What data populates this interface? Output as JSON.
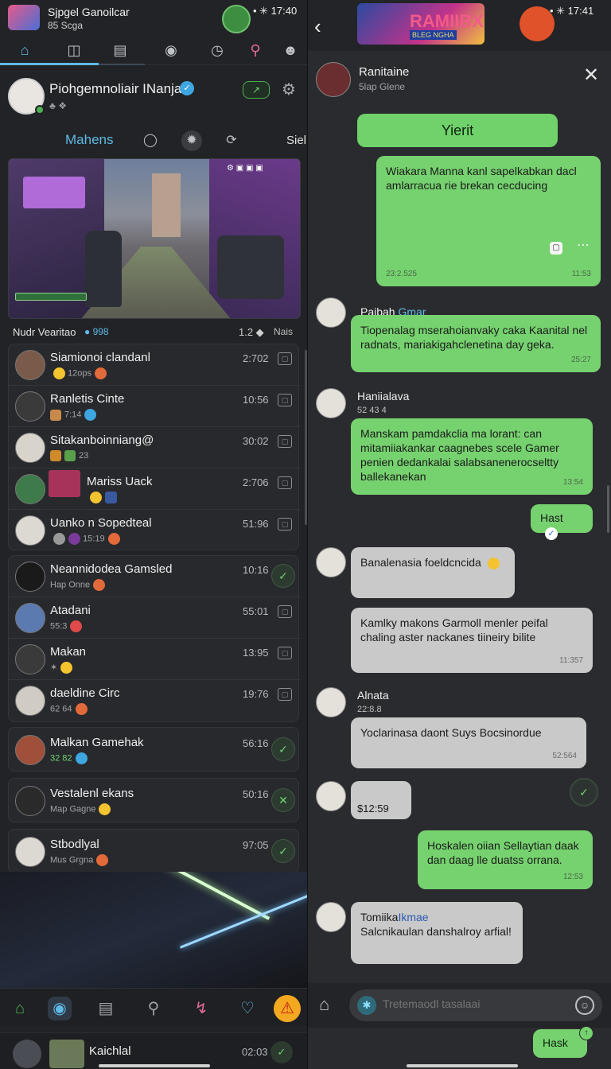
{
  "left": {
    "status": {
      "app_name": "Sjpgel Ganoilcar",
      "app_sub": "85 Scga",
      "system": "• ✳ 17:40"
    },
    "profile": {
      "name": "Piohgemnoliair INanjan",
      "sub": "♣ ❖",
      "trend_label": "↗"
    },
    "subtabs": {
      "active": "Mahens",
      "right": "Siel"
    },
    "game_image": {
      "hud": "⚙ ▣ ▣ ▣"
    },
    "list_head": {
      "title": "Nudr Vearitao",
      "count": "● 998",
      "num": "1.2 ◆",
      "right": "Nais"
    },
    "card1": [
      {
        "name": "Siamionoi clandanl",
        "sub": "12ops",
        "time": "2:702"
      },
      {
        "name": "Ranletis Cinte",
        "sub": "7:14",
        "time": "10:56"
      },
      {
        "name": "Sitakanboinniang@",
        "sub": "23",
        "time": "30:02"
      },
      {
        "name": "Mariss Uack",
        "sub": "",
        "time": "2:706"
      },
      {
        "name": "Uanko n Sopedteal",
        "sub": "15:19",
        "time": "51:96"
      }
    ],
    "card2": [
      {
        "name": "Neannidodea Gamsled",
        "sub": "Hap Onne",
        "time": "10:16"
      },
      {
        "name": "Atadani",
        "sub": "55:3",
        "time": "55:01"
      },
      {
        "name": "Makan",
        "sub": "✶",
        "time": "13:95"
      },
      {
        "name": "daeldine Circ",
        "sub": "62 64",
        "time": "19:76"
      }
    ],
    "card3": [
      {
        "name": "Malkan Gamehak",
        "sub": "32 82",
        "time": "56:16"
      }
    ],
    "card4": [
      {
        "name": "Vestalenl ekans",
        "sub": "Map Gagne",
        "time": "50:16"
      }
    ],
    "card5": [
      {
        "name": "Stbodlyal",
        "sub": "Mus Grgna",
        "time": "97:05"
      }
    ],
    "footer": {
      "name": "Kaichlal",
      "time": "02:03"
    }
  },
  "right": {
    "status": {
      "logo_text": "RAMIIBX",
      "logo_sub": "BLEG NGHA",
      "system": "• ✳ 17:41"
    },
    "chat": {
      "name": "Ranitaine",
      "sub": "5lap Glene"
    },
    "action_label": "Yierit",
    "messages": [
      {
        "text": "Wiakara Manna kanl sapelkabkan dacl amlarracua rie brekan cecducing",
        "meta": "11:53",
        "meta_left": "23:2.525"
      },
      {
        "sender": "Paibah",
        "sender2": "Gmar",
        "text": "Tiopenalag mserahoianvaky caka Kaanital nel radnats, mariakigahclenetina day geka.",
        "meta": "25:27"
      },
      {
        "sender": "Haniialava",
        "sender_sub": "52 43 4",
        "text": "Manskam pamdakclia ma lorant: can mitamiiakankar caagnebes scele Gamer penien dedankalai salabsanenerocseltty ballekanekan",
        "meta": "13:54"
      },
      {
        "text": "Hast"
      },
      {
        "text": "Banalenasia foeldcncida"
      },
      {
        "text": "Kamlky makons Garmoll menler peifal chaling aster nackanes tiineiry bilite",
        "meta": "11:357"
      },
      {
        "sender": "Alnata",
        "sender_sub": "22:8.8",
        "text": "Yoclarinasa daont Suys Bocsinordue",
        "meta": "52:564"
      },
      {
        "text": "$12:59"
      },
      {
        "text": "Hoskalen oiian Sellaytian daak dan daag lle duatss orrana.",
        "meta": "12:53"
      },
      {
        "sender": "Tomiika",
        "sender2": "Ikmae",
        "text": "Salcnikaulan danshalroy arfial!"
      }
    ],
    "composer": {
      "placeholder": "Tretemaodl tasalaai"
    },
    "send_label": "Hask"
  }
}
